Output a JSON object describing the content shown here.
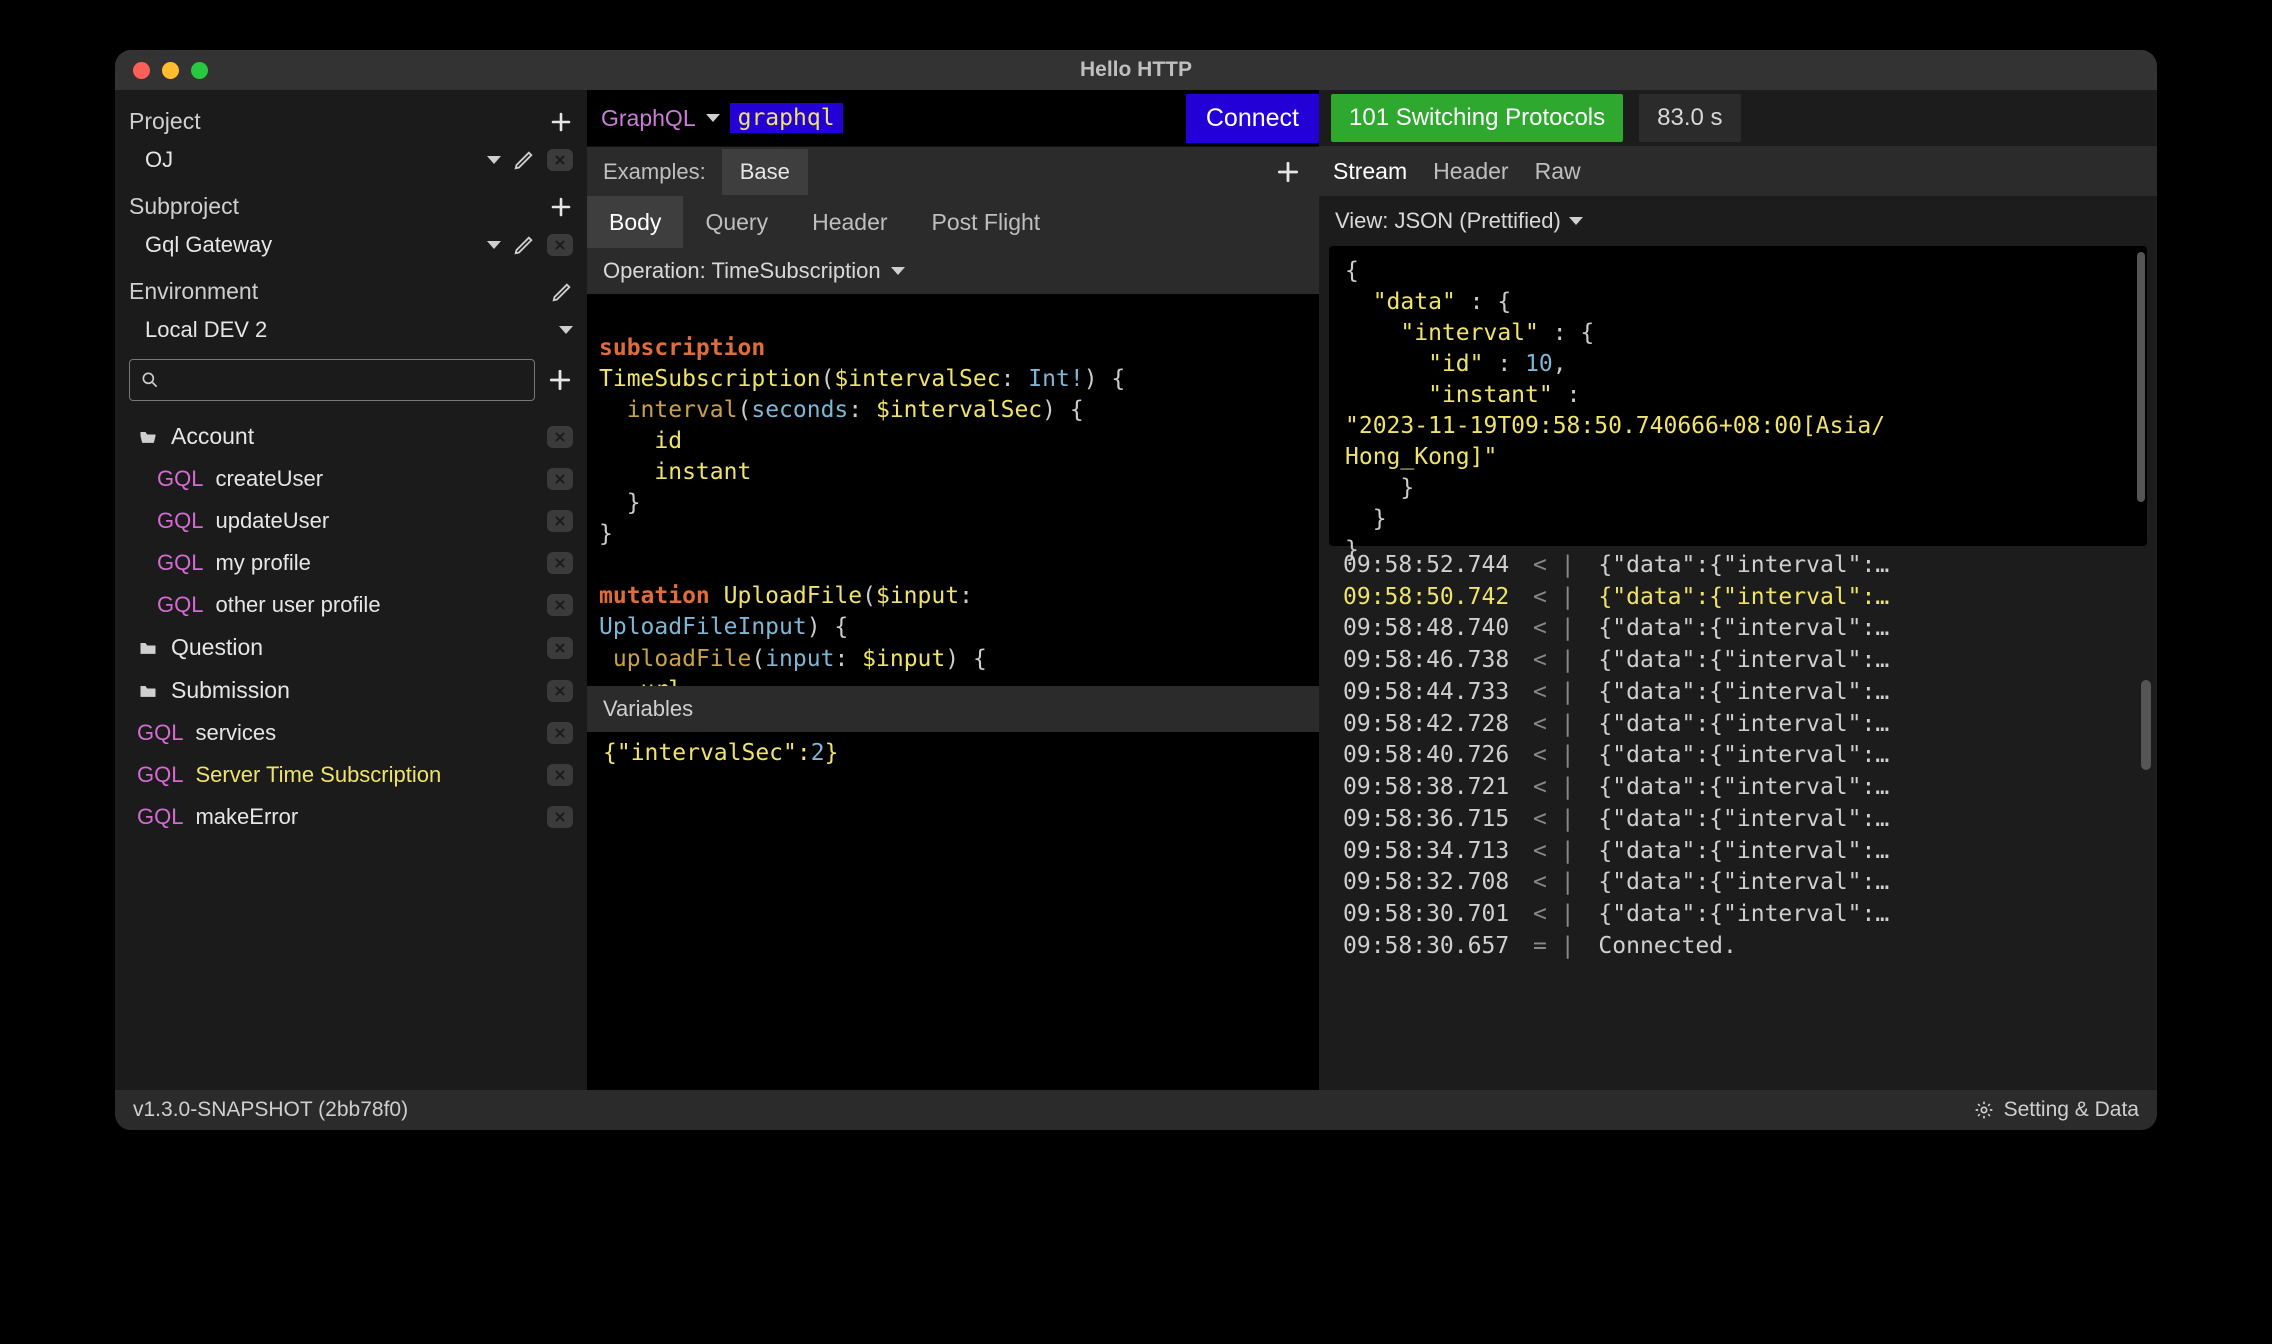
{
  "window": {
    "title": "Hello HTTP"
  },
  "sidebar": {
    "project": {
      "label": "Project",
      "value": "OJ"
    },
    "subproject": {
      "label": "Subproject",
      "value": "Gql Gateway"
    },
    "environment": {
      "label": "Environment",
      "value": "Local DEV 2"
    },
    "search_placeholder": "",
    "tree": [
      {
        "type": "folder-open",
        "label": "Account",
        "children": [
          {
            "tag": "GQL",
            "label": "createUser"
          },
          {
            "tag": "GQL",
            "label": "updateUser"
          },
          {
            "tag": "GQL",
            "label": "my profile"
          },
          {
            "tag": "GQL",
            "label": "other user profile"
          }
        ]
      },
      {
        "type": "folder",
        "label": "Question"
      },
      {
        "type": "folder",
        "label": "Submission"
      },
      {
        "type": "item",
        "tag": "GQL",
        "label": "services"
      },
      {
        "type": "item",
        "tag": "GQL",
        "label": "Server Time Subscription",
        "active": true
      },
      {
        "type": "item",
        "tag": "GQL",
        "label": "makeError"
      }
    ]
  },
  "request": {
    "protocol_label": "GraphQL",
    "protocol_name": "graphql",
    "connect_label": "Connect",
    "examples_label": "Examples:",
    "examples_tab": "Base",
    "tabs": [
      "Body",
      "Query",
      "Header",
      "Post Flight"
    ],
    "active_tab": "Body",
    "operation_label": "Operation: TimeSubscription",
    "vars_label": "Variables",
    "vars_body_key": "\"intervalSec\"",
    "vars_body_val": "2"
  },
  "response": {
    "status": "101 Switching Protocols",
    "timing": "83.0 s",
    "tabs": [
      "Stream",
      "Header",
      "Raw"
    ],
    "active_tab": "Stream",
    "view_label": "View: JSON (Prettified)",
    "json_lines": [
      "{",
      "  \"data\" : {",
      "    \"interval\" : {",
      "      \"id\" : 10,",
      "      \"instant\" : \"2023-11-19T09:58:50.740666+08:00[Asia/Hong_Kong]\"",
      "    }",
      "  }",
      "}"
    ],
    "log": [
      {
        "t": "09:58:52.744",
        "d": "<",
        "m": "{\"data\":{\"interval\":…"
      },
      {
        "t": "09:58:50.742",
        "d": "<",
        "m": "{\"data\":{\"interval\":…",
        "hl": true
      },
      {
        "t": "09:58:48.740",
        "d": "<",
        "m": "{\"data\":{\"interval\":…"
      },
      {
        "t": "09:58:46.738",
        "d": "<",
        "m": "{\"data\":{\"interval\":…"
      },
      {
        "t": "09:58:44.733",
        "d": "<",
        "m": "{\"data\":{\"interval\":…"
      },
      {
        "t": "09:58:42.728",
        "d": "<",
        "m": "{\"data\":{\"interval\":…"
      },
      {
        "t": "09:58:40.726",
        "d": "<",
        "m": "{\"data\":{\"interval\":…"
      },
      {
        "t": "09:58:38.721",
        "d": "<",
        "m": "{\"data\":{\"interval\":…"
      },
      {
        "t": "09:58:36.715",
        "d": "<",
        "m": "{\"data\":{\"interval\":…"
      },
      {
        "t": "09:58:34.713",
        "d": "<",
        "m": "{\"data\":{\"interval\":…"
      },
      {
        "t": "09:58:32.708",
        "d": "<",
        "m": "{\"data\":{\"interval\":…"
      },
      {
        "t": "09:58:30.701",
        "d": "<",
        "m": "{\"data\":{\"interval\":…"
      },
      {
        "t": "09:58:30.657",
        "d": "=",
        "m": "Connected."
      }
    ]
  },
  "footer": {
    "version": "v1.3.0-SNAPSHOT (2bb78f0)",
    "settings_label": "Setting & Data"
  }
}
